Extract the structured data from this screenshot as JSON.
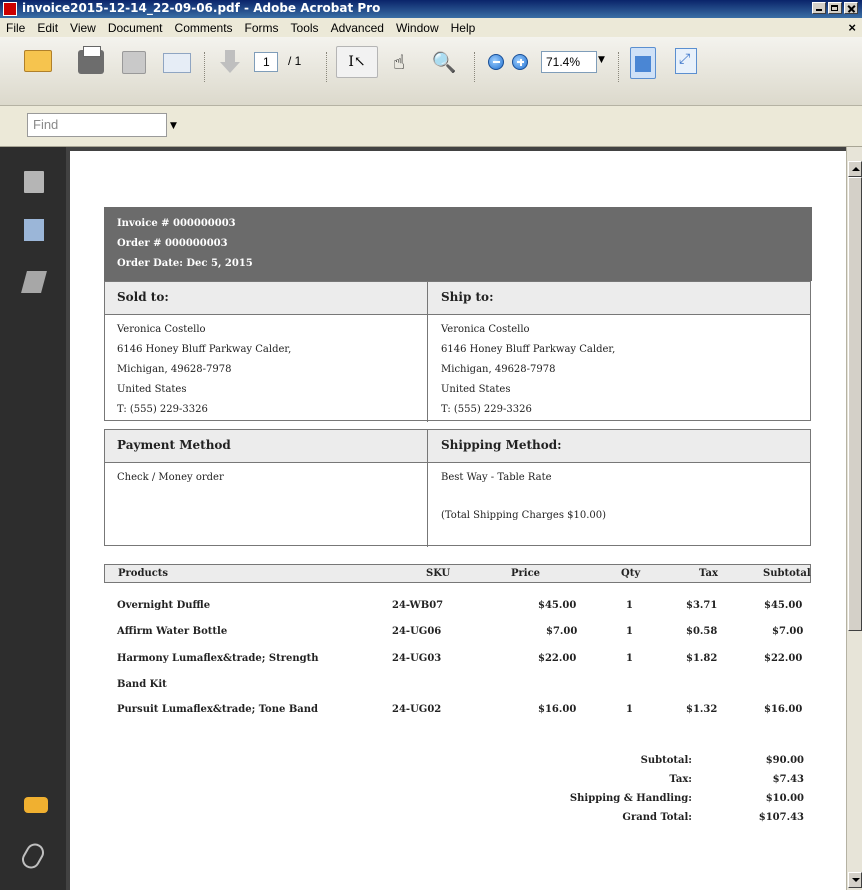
{
  "window": {
    "title": "invoice2015-12-14_22-09-06.pdf - Adobe Acrobat Pro"
  },
  "menu": [
    "File",
    "Edit",
    "View",
    "Document",
    "Comments",
    "Forms",
    "Tools",
    "Advanced",
    "Window",
    "Help"
  ],
  "toolbar": {
    "current_page": "1",
    "page_total": "/ 1",
    "zoom": "71.4%"
  },
  "find": {
    "placeholder": "Find"
  },
  "invoice": {
    "invoice_no": "Invoice # 000000003",
    "order_no": "Order # 000000003",
    "order_date": "Order Date: Dec 5, 2015",
    "sold_to_label": "Sold to:",
    "ship_to_label": "Ship to:",
    "sold_to": [
      "Veronica Costello",
      "6146 Honey Bluff Parkway Calder,",
      "Michigan, 49628-7978",
      "United States",
      "T: (555) 229-3326"
    ],
    "ship_to": [
      "Veronica Costello",
      "6146 Honey Bluff Parkway Calder,",
      "Michigan, 49628-7978",
      "United States",
      "T: (555) 229-3326"
    ],
    "payment_label": "Payment Method",
    "shipping_label": "Shipping Method:",
    "payment_method": "Check / Money order",
    "shipping_method": "Best Way - Table Rate",
    "shipping_charges": "(Total Shipping Charges $10.00)",
    "columns": [
      "Products",
      "SKU",
      "Price",
      "Qty",
      "Tax",
      "Subtotal"
    ],
    "items": [
      {
        "name": "Overnight Duffle",
        "sku": "24-WB07",
        "price": "$45.00",
        "qty": "1",
        "tax": "$3.71",
        "subtotal": "$45.00"
      },
      {
        "name": "Affirm Water Bottle",
        "sku": "24-UG06",
        "price": "$7.00",
        "qty": "1",
        "tax": "$0.58",
        "subtotal": "$7.00"
      },
      {
        "name": "Harmony Lumaflex&trade; Strength",
        "name2": "Band Kit",
        "sku": "24-UG03",
        "price": "$22.00",
        "qty": "1",
        "tax": "$1.82",
        "subtotal": "$22.00"
      },
      {
        "name": "Pursuit Lumaflex&trade; Tone Band",
        "sku": "24-UG02",
        "price": "$16.00",
        "qty": "1",
        "tax": "$1.32",
        "subtotal": "$16.00"
      }
    ],
    "totals": [
      {
        "label": "Subtotal:",
        "value": "$90.00"
      },
      {
        "label": "Tax:",
        "value": "$7.43"
      },
      {
        "label": "Shipping & Handling:",
        "value": "$10.00"
      },
      {
        "label": "Grand Total:",
        "value": "$107.43"
      }
    ]
  },
  "icons": {
    "nav": [
      "pages-icon",
      "bookmarks-icon",
      "signatures-icon",
      "comments-icon",
      "attachments-icon"
    ]
  }
}
